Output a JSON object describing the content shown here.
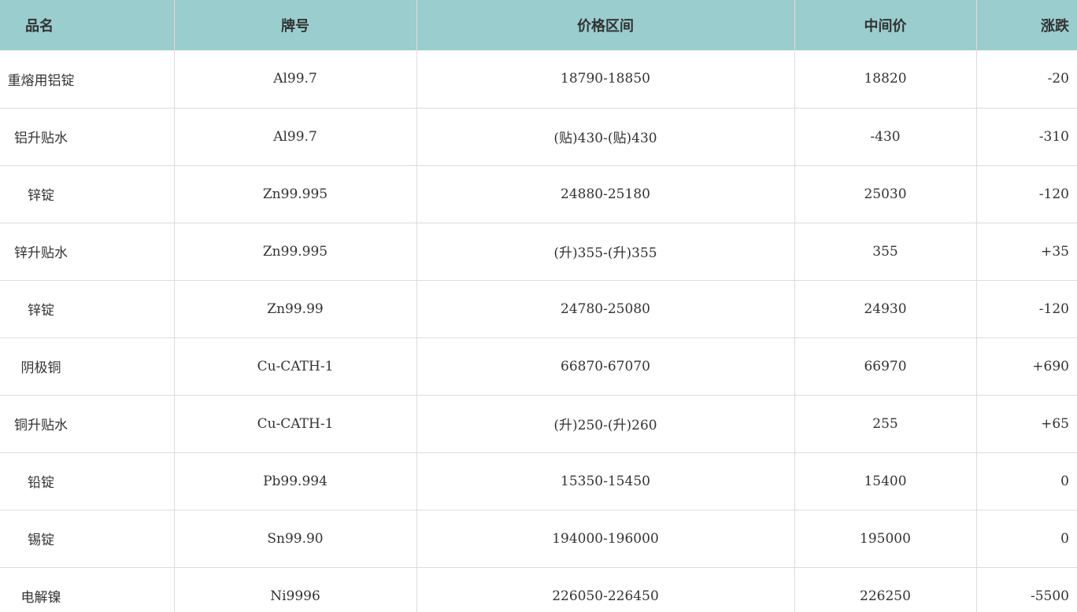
{
  "table": {
    "headers": [
      "品名",
      "牌号",
      "价格区间",
      "中间价",
      "涨跌"
    ],
    "rows": [
      [
        "重熔用铝锭",
        "Al99.7",
        "18790-18850",
        "18820",
        "-20"
      ],
      [
        "铝升贴水",
        "Al99.7",
        "(贴)430-(贴)430",
        "-430",
        "-310"
      ],
      [
        "锌锭",
        "Zn99.995",
        "24880-25180",
        "25030",
        "-120"
      ],
      [
        "锌升贴水",
        "Zn99.995",
        "(升)355-(升)355",
        "355",
        "+35"
      ],
      [
        "锌锭",
        "Zn99.99",
        "24780-25080",
        "24930",
        "-120"
      ],
      [
        "阴极铜",
        "Cu-CATH-1",
        "66870-67070",
        "66970",
        "+690"
      ],
      [
        "铜升贴水",
        "Cu-CATH-1",
        "(升)250-(升)260",
        "255",
        "+65"
      ],
      [
        "铅锭",
        "Pb99.994",
        "15350-15450",
        "15400",
        "0"
      ],
      [
        "锡锭",
        "Sn99.90",
        "194000-196000",
        "195000",
        "0"
      ],
      [
        "电解镍",
        "Ni9996",
        "226050-226450",
        "226250",
        "-5500"
      ]
    ]
  }
}
